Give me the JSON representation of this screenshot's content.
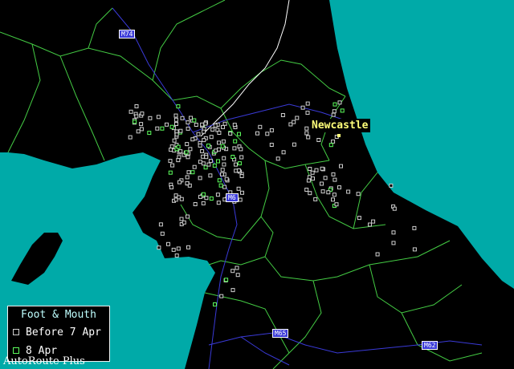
{
  "legend": {
    "title": "Foot & Mouth",
    "entries": [
      {
        "label": "Before 7 Apr",
        "color": "#cfcfcf"
      },
      {
        "label": "8 Apr",
        "color": "#5dff5d"
      }
    ]
  },
  "city": {
    "name": "Newcastle"
  },
  "roads": [
    "M74",
    "M6",
    "M65",
    "M62"
  ],
  "brand": "AutoRoute Plus",
  "colors": {
    "sea": "#00aaa8",
    "land": "#000000",
    "boundary": "#44cc44",
    "road": "#3a3ad8",
    "label": "#ffff7a"
  }
}
